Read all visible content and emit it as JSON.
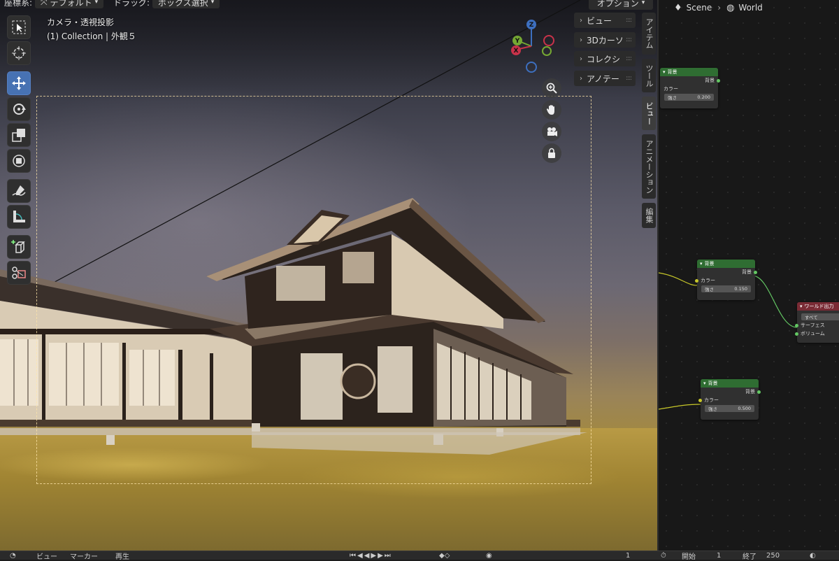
{
  "header": {
    "coord_label": "座標系:",
    "coord_value": "デフォルト",
    "drag_label": "ドラッグ:",
    "drag_value": "ボックス選択",
    "options_label": "オプション"
  },
  "viewport": {
    "camera_label": "カメラ・透視投影",
    "collection_label": "(1) Collection | 外観５"
  },
  "gizmo": {
    "z": "Z",
    "y": "Y",
    "x": "X"
  },
  "popovers": [
    {
      "label": "ビュー"
    },
    {
      "label": "3Dカーソ"
    },
    {
      "label": "コレクシ"
    },
    {
      "label": "アノテー"
    }
  ],
  "sidebar_tabs": [
    "アイテム",
    "ツール",
    "ビュー",
    "アニメーション",
    "編集"
  ],
  "breadcrumb": {
    "scene": "Scene",
    "world": "World"
  },
  "nodes": {
    "bg1": {
      "title": "背景",
      "output": "背景",
      "color_label": "カラー",
      "strength_label": "強さ",
      "strength_value": "0.200"
    },
    "bg2": {
      "title": "背景",
      "output": "背景",
      "color_label": "カラー",
      "strength_label": "強さ",
      "strength_value": "0.150"
    },
    "bg3": {
      "title": "背景",
      "output": "背景",
      "color_label": "カラー",
      "strength_label": "強さ",
      "strength_value": "0.500"
    },
    "world_output": {
      "title": "ワールド出力",
      "target": "すべて",
      "surface": "サーフェス",
      "volume": "ボリューム"
    }
  },
  "statusbar": {
    "left1": "ビュー",
    "left2": "マーカー",
    "left3": "再生",
    "frame_current": "1",
    "start_label": "開始",
    "start_value": "1",
    "end_label": "終了",
    "end_value": "250"
  },
  "colors": {
    "accent": "#4772b3",
    "node_green": "#2f6d32",
    "node_red": "#7a2b35"
  }
}
